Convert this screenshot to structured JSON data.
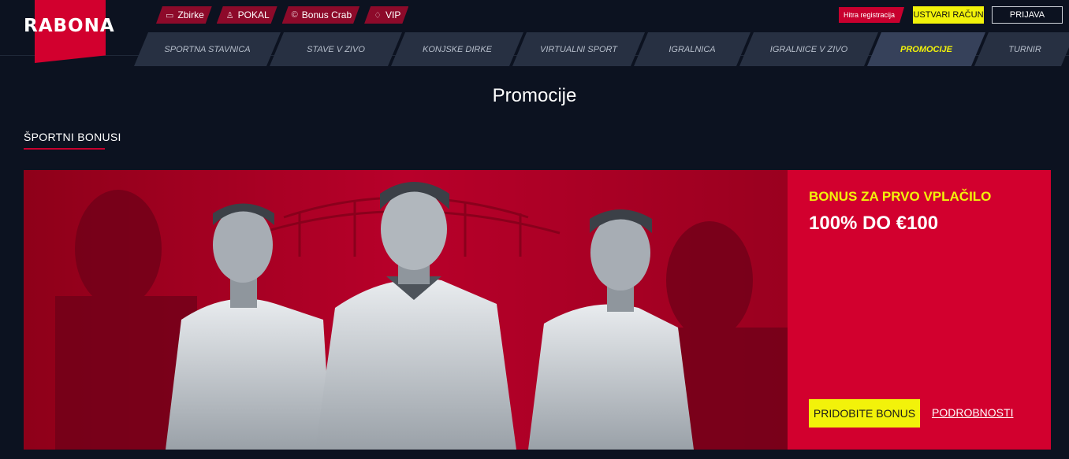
{
  "brand": {
    "logo": "RABONA"
  },
  "quick_links": [
    {
      "label": "Zbirke",
      "icon": "book-icon"
    },
    {
      "label": "POKAL",
      "icon": "trophy-icon"
    },
    {
      "label": "Bonus Crab",
      "icon": "crab-icon"
    },
    {
      "label": "VIP",
      "icon": "diamond-icon"
    }
  ],
  "account": {
    "quick_register": "Hitra registracija",
    "create_account": "USTVARI RAČUN",
    "login": "PRIJAVA"
  },
  "nav": {
    "tabs": [
      {
        "label": "SPORTNA STAVNICA"
      },
      {
        "label": "STAVE V ZIVO"
      },
      {
        "label": "KONJSKE DIRKE"
      },
      {
        "label": "VIRTUALNI SPORT"
      },
      {
        "label": "IGRALNICA"
      },
      {
        "label": "IGRALNICE V ZIVO"
      },
      {
        "label": "PROMOCIJE",
        "active": true
      },
      {
        "label": "TURNIR"
      }
    ]
  },
  "page": {
    "title": "Promocije",
    "section_title": "ŠPORTNI BONUSI"
  },
  "promo": {
    "subtitle": "BONUS ZA PRVO VPLAČILO",
    "title": "100% DO €100",
    "primary_button": "PRIDOBITE BONUS",
    "details_link": "PODROBNOSTI"
  },
  "colors": {
    "background": "#0c1220",
    "accent_red": "#d2002e",
    "accent_yellow": "#f2f20a",
    "nav_tab": "#273042"
  }
}
